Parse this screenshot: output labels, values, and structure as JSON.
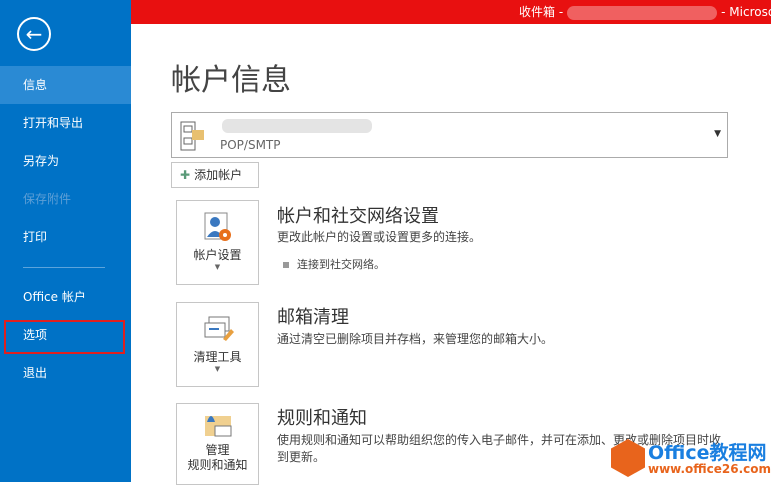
{
  "titlebar": {
    "prefix": "收件箱 -",
    "suffix": "- Microso"
  },
  "sidebar": {
    "items": [
      {
        "label": "信息"
      },
      {
        "label": "打开和导出"
      },
      {
        "label": "另存为"
      },
      {
        "label": "保存附件"
      },
      {
        "label": "打印"
      },
      {
        "label": "Office 帐户"
      },
      {
        "label": "选项"
      },
      {
        "label": "退出"
      }
    ]
  },
  "main": {
    "title": "帐户信息",
    "account": {
      "type": "POP/SMTP"
    },
    "add_account": "添加帐户",
    "sections": [
      {
        "tile": "帐户设置",
        "heading": "帐户和社交网络设置",
        "desc": "更改此帐户的设置或设置更多的连接。",
        "link": "连接到社交网络。"
      },
      {
        "tile": "清理工具",
        "heading": "邮箱清理",
        "desc": "通过清空已删除项目并存档，来管理您的邮箱大小。"
      },
      {
        "tile": "管理",
        "tile2": "规则和通知",
        "heading": "规则和通知",
        "desc": "使用规则和通知可以帮助组织您的传入电子邮件，并可在添加、更改或删除项目时收到更新。"
      }
    ]
  },
  "watermark": {
    "line1": "Office教程网",
    "line2": "www.office26.com"
  }
}
